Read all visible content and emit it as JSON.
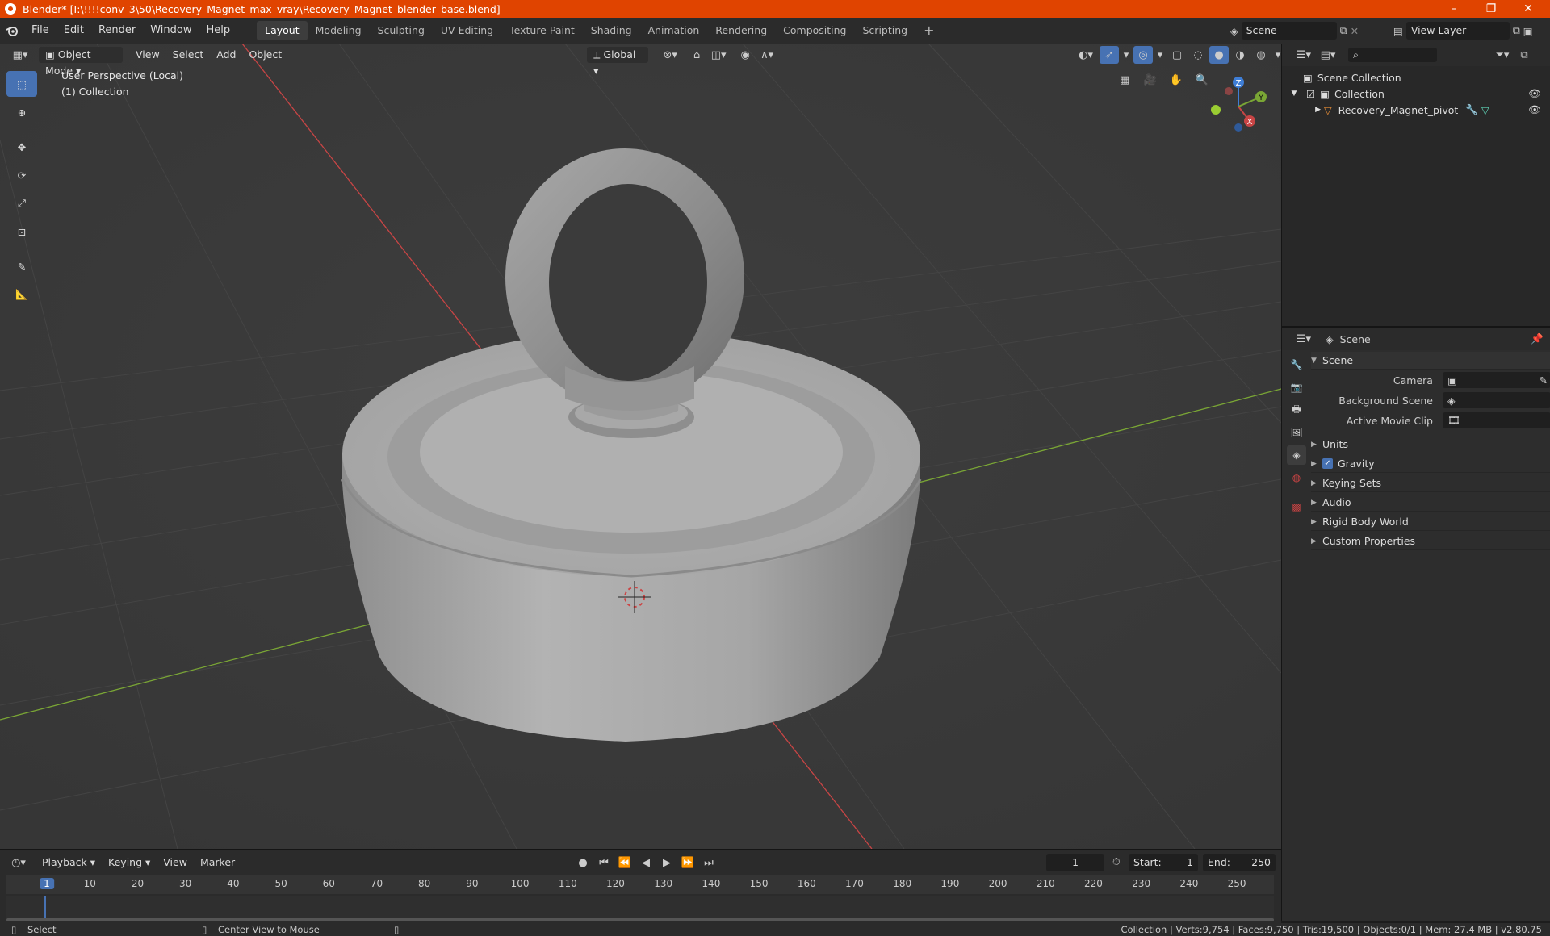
{
  "window": {
    "title": "Blender* [I:\\!!!!conv_3\\50\\Recovery_Magnet_max_vray\\Recovery_Magnet_blender_base.blend]",
    "controls": [
      "–",
      "❐",
      "✕"
    ]
  },
  "menu": [
    "File",
    "Edit",
    "Render",
    "Window",
    "Help"
  ],
  "workspaces": [
    "Layout",
    "Modeling",
    "Sculpting",
    "UV Editing",
    "Texture Paint",
    "Shading",
    "Animation",
    "Rendering",
    "Compositing",
    "Scripting"
  ],
  "workspace_add": "+",
  "scene_field": "Scene",
  "view_layer_field": "View Layer",
  "viewport": {
    "mode": "Object Mode",
    "menus": [
      "View",
      "Select",
      "Add",
      "Object"
    ],
    "transform_orientation": "Global",
    "info_line1": "User Perspective (Local)",
    "info_line2": "(1) Collection",
    "gizmo": {
      "z": "Z",
      "y": "Y",
      "x": "X"
    }
  },
  "outliner": {
    "search_placeholder": "",
    "scene_collection": "Scene Collection",
    "collection": "Collection",
    "object": "Recovery_Magnet_pivot"
  },
  "properties": {
    "context": "Scene",
    "section": "Scene",
    "camera_label": "Camera",
    "background_scene_label": "Background Scene",
    "active_movie_clip_label": "Active Movie Clip",
    "panels": [
      "Units",
      "Gravity",
      "Keying Sets",
      "Audio",
      "Rigid Body World",
      "Custom Properties"
    ]
  },
  "timeline": {
    "menus": [
      "Playback",
      "Keying",
      "View",
      "Marker"
    ],
    "current_frame": "1",
    "start_label": "Start:",
    "start_value": "1",
    "end_label": "End:",
    "end_value": "250",
    "ticks": [
      "1",
      "10",
      "20",
      "30",
      "40",
      "50",
      "60",
      "70",
      "80",
      "90",
      "100",
      "110",
      "120",
      "130",
      "140",
      "150",
      "160",
      "170",
      "180",
      "190",
      "200",
      "210",
      "220",
      "230",
      "240",
      "250"
    ]
  },
  "status": {
    "select": "Select",
    "center_view": "Center View to Mouse",
    "info": "Collection | Verts:9,754 | Faces:9,750 | Tris:19,500 | Objects:0/1 | Mem: 27.4 MB | v2.80.75"
  },
  "colors": {
    "title_bar": "#e04400",
    "active_tool": "#4772b3",
    "axis_x": "#c84545",
    "axis_y": "#7aa635",
    "axis_z": "#3f7ed6"
  }
}
